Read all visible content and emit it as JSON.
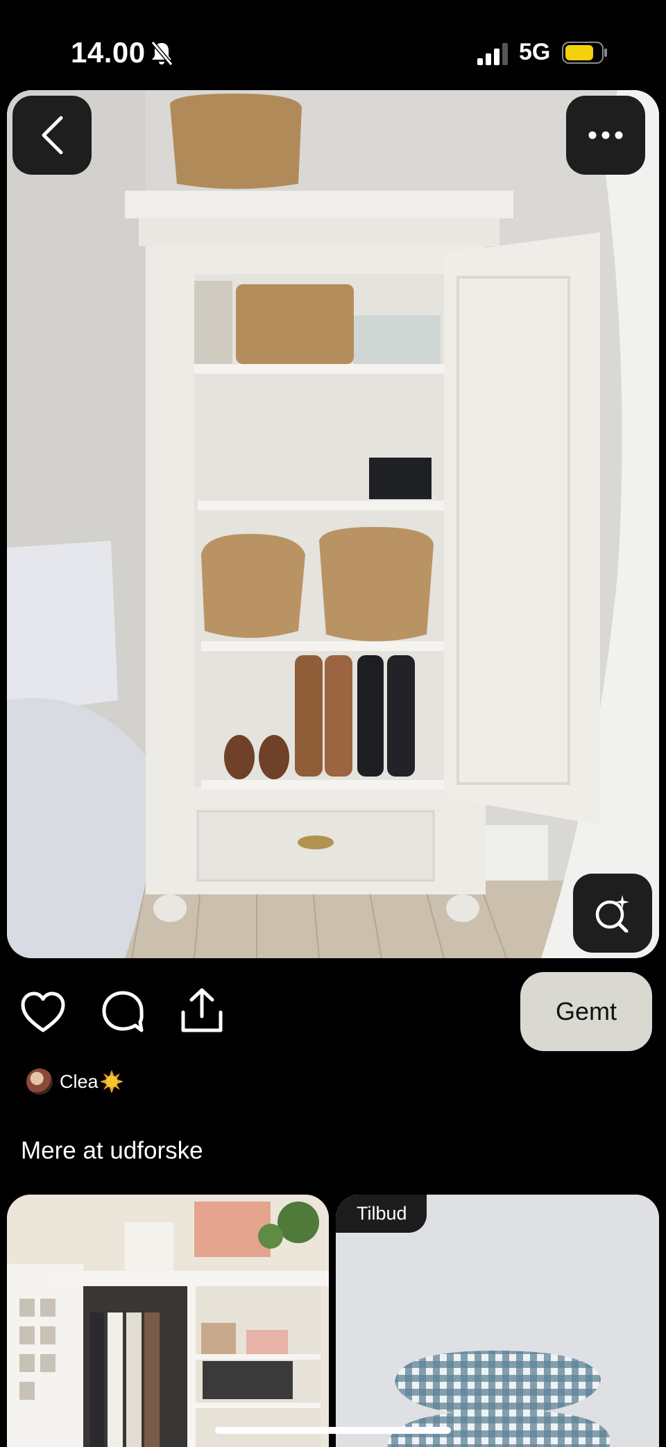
{
  "status_bar": {
    "time": "14.00",
    "network": "5G",
    "battery_color": "#f5d10b"
  },
  "pin": {
    "image_description_icon": "armoire-photo"
  },
  "actions": {
    "save_label": "Gemt"
  },
  "author": {
    "name": "Clea"
  },
  "explore": {
    "title": "Mere at udforske",
    "cards": [
      {
        "tag": ""
      },
      {
        "tag": "Tilbud"
      }
    ]
  }
}
